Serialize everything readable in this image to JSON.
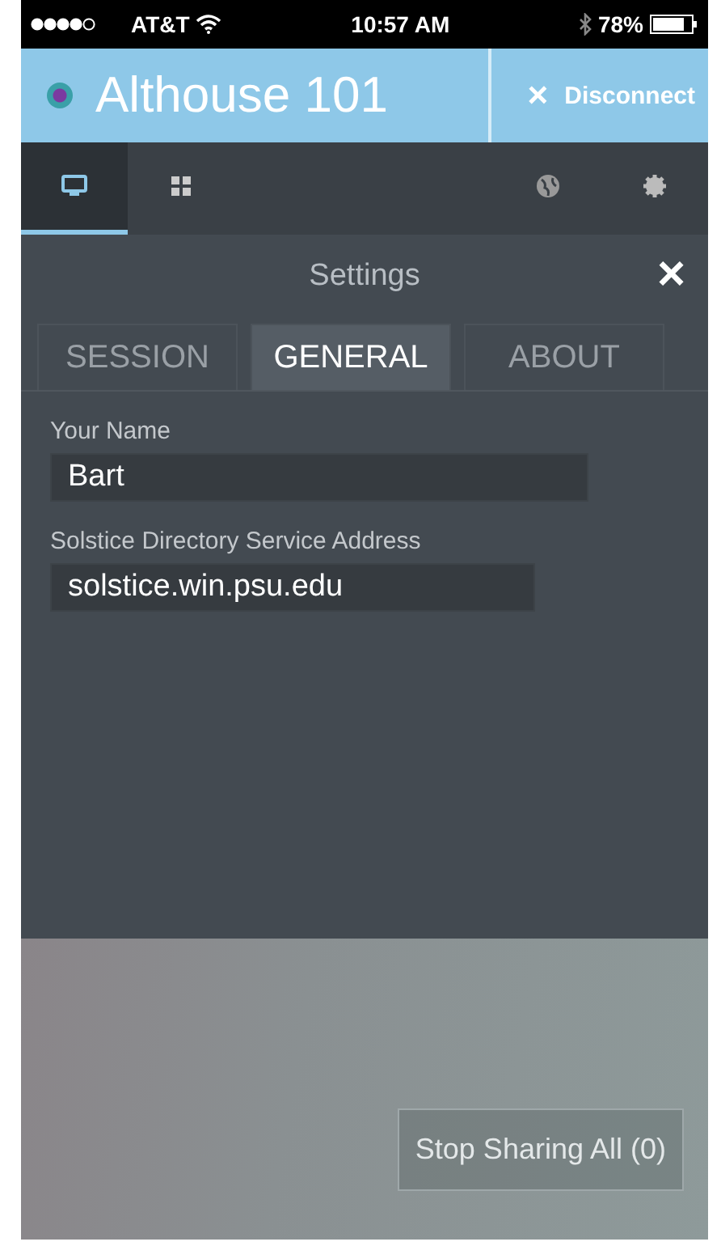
{
  "status_bar": {
    "carrier": "AT&T",
    "time": "10:57 AM",
    "battery": "78%"
  },
  "header": {
    "title": "Althouse 101",
    "disconnect": "Disconnect",
    "close_glyph": "×"
  },
  "toolbar": [
    {
      "kind": "monitor",
      "selected": true
    },
    {
      "kind": "grid",
      "selected": false
    },
    {
      "kind": "globe",
      "selected": false
    },
    {
      "kind": "gear",
      "selected": false
    }
  ],
  "settings": {
    "title": "Settings",
    "close_glyph": "×",
    "tabs": [
      {
        "label": "SESSION",
        "selected": false
      },
      {
        "label": "GENERAL",
        "selected": true
      },
      {
        "label": "ABOUT",
        "selected": false
      }
    ],
    "fields": [
      {
        "label": "Your Name",
        "value": "Bart"
      },
      {
        "label": "Solstice Directory Service Address",
        "value": "solstice.win.psu.edu"
      }
    ]
  },
  "stop_button": {
    "label": "Stop Sharing All (0)",
    "disabled": true
  }
}
